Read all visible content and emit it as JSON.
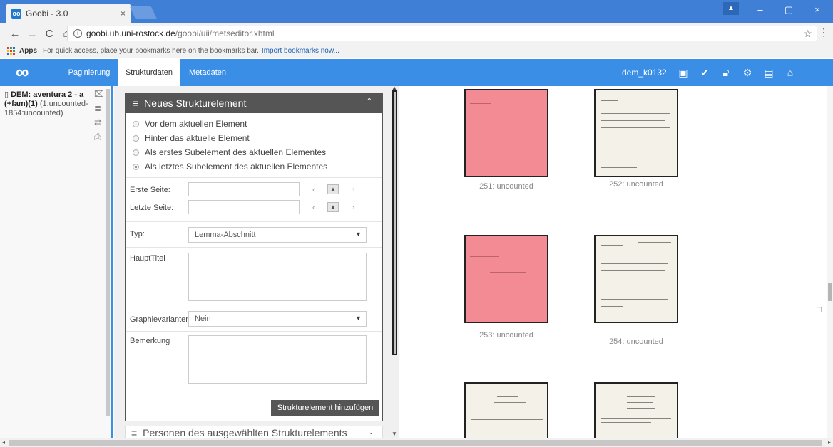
{
  "browser": {
    "tab_title": "Goobi - 3.0",
    "tab_close": "×",
    "url_host": "goobi.ub.uni-rostock.de",
    "url_path": "/goobi/uii/metseditor.xhtml",
    "back_icon": "←",
    "forward_icon": "→",
    "reload_icon": "C",
    "home_icon": "⌂",
    "star_icon": "☆",
    "menu_icon": "⋮",
    "win_minimize": "–",
    "win_restore": "▢",
    "win_close": "×",
    "bookmarks_apps": "Apps",
    "bookmarks_text": "For quick access, place your bookmarks here on the bookmarks bar.",
    "bookmarks_link": "Import bookmarks now..."
  },
  "header": {
    "logo": "∞",
    "tabs": [
      {
        "label": "Paginierung"
      },
      {
        "label": "Strukturdaten"
      },
      {
        "label": "Metadaten"
      }
    ],
    "user": "dem_k0132",
    "icons": [
      "image-icon",
      "check-icon",
      "unlock-icon",
      "gear-icon",
      "save-icon",
      "home-icon"
    ]
  },
  "tree": {
    "title_bold": "DEM: aventura 2 - a",
    "title_bold2": "(+fam)(1)",
    "title_rest": " (1:uncounted-1854:uncounted)"
  },
  "form": {
    "panel_title": "Neues Strukturelement",
    "radios": [
      {
        "label": "Vor dem aktuellen Element",
        "checked": false
      },
      {
        "label": "Hinter das aktuelle Element",
        "checked": false
      },
      {
        "label": "Als erstes Subelement des aktuellen Elementes",
        "checked": false
      },
      {
        "label": "Als letztes Subelement des aktuellen Elementes",
        "checked": true
      }
    ],
    "first_page_label": "Erste Seite:",
    "last_page_label": "Letzte Seite:",
    "type_label": "Typ:",
    "type_value": "Lemma-Abschnitt",
    "main_title_label": "HauptTitel",
    "graphic_label": "Graphievarianten",
    "graphic_value": "Nein",
    "remark_label": "Bemerkung",
    "add_button": "Strukturelement hinzufügen",
    "persons_panel_title": "Personen des ausgewählten Strukturelements"
  },
  "thumbnails": [
    {
      "label": "251: uncounted",
      "style": "pink"
    },
    {
      "label": "252: uncounted",
      "style": "card"
    },
    {
      "label": "253: uncounted",
      "style": "pink"
    },
    {
      "label": "254: uncounted",
      "style": "card"
    },
    {
      "label": "",
      "style": "card"
    },
    {
      "label": "",
      "style": "card"
    }
  ],
  "colors": {
    "tabstrip": "#3f7fd6",
    "app_header": "#3a8ee6",
    "panel_header": "#555555",
    "pink_card": "#f28b94"
  }
}
